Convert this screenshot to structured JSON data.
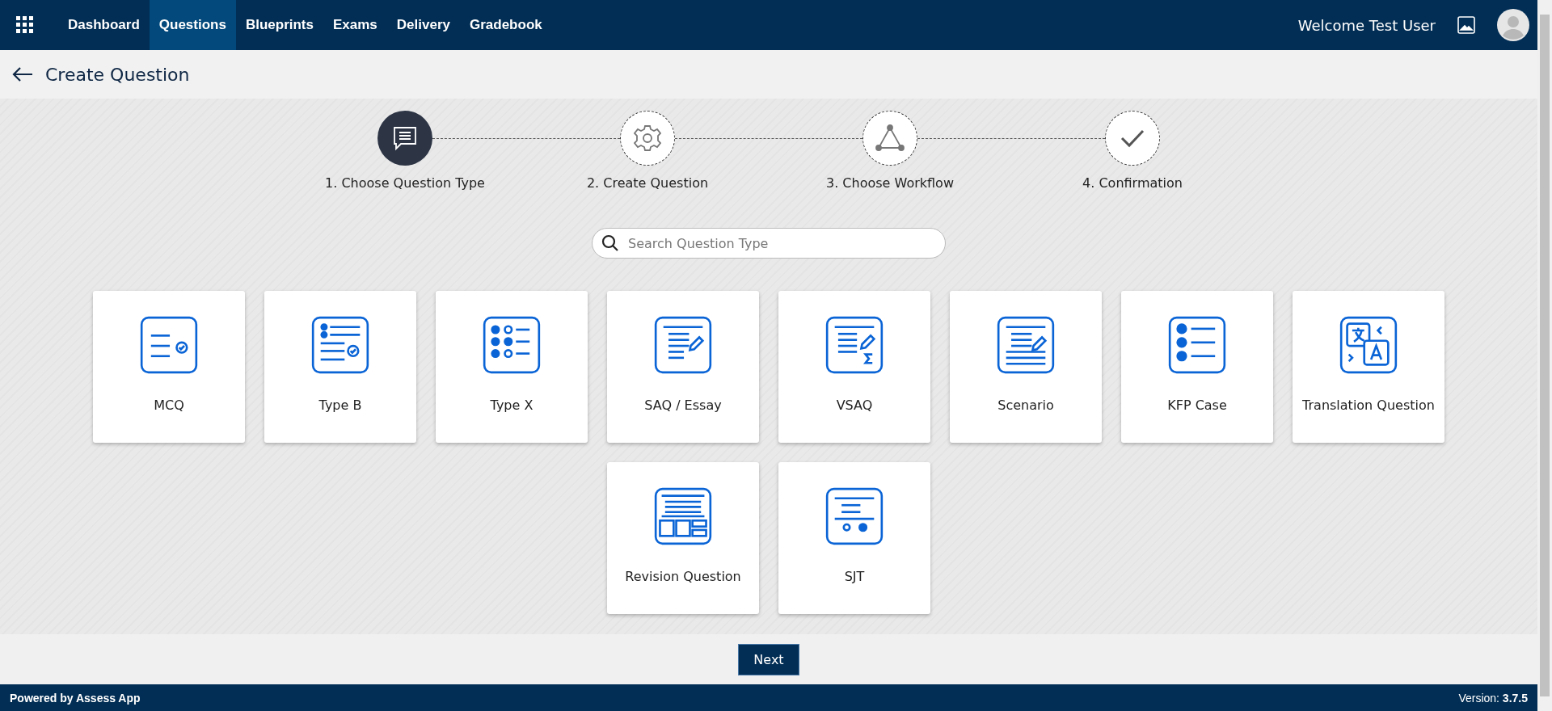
{
  "nav": {
    "items": [
      {
        "label": "Dashboard",
        "selected": false
      },
      {
        "label": "Questions",
        "selected": true
      },
      {
        "label": "Blueprints",
        "selected": false
      },
      {
        "label": "Exams",
        "selected": false
      },
      {
        "label": "Delivery",
        "selected": false
      },
      {
        "label": "Gradebook",
        "selected": false
      }
    ],
    "welcome": "Welcome Test User"
  },
  "page_title": "Create Question",
  "steps": [
    {
      "label": "1. Choose Question Type",
      "kind": "chat",
      "selected": true
    },
    {
      "label": "2. Create Question",
      "kind": "gear",
      "selected": false
    },
    {
      "label": "3. Choose Workflow",
      "kind": "triangle",
      "selected": false
    },
    {
      "label": "4. Confirmation",
      "kind": "check",
      "selected": false
    }
  ],
  "search": {
    "placeholder": "Search Question Type"
  },
  "question_types": [
    {
      "label": "MCQ",
      "kind": "mcq"
    },
    {
      "label": "Type B",
      "kind": "typeb"
    },
    {
      "label": "Type X",
      "kind": "typex"
    },
    {
      "label": "SAQ / Essay",
      "kind": "essay"
    },
    {
      "label": "VSAQ",
      "kind": "vsaq"
    },
    {
      "label": "Scenario",
      "kind": "scenario"
    },
    {
      "label": "KFP Case",
      "kind": "kfp"
    },
    {
      "label": "Translation Question",
      "kind": "translation"
    },
    {
      "label": "Revision Question",
      "kind": "revision"
    },
    {
      "label": "SJT",
      "kind": "sjt"
    }
  ],
  "next_button": "Next",
  "footer": {
    "powered": "Powered by Assess App",
    "version": "Version: **3.7.5**"
  }
}
